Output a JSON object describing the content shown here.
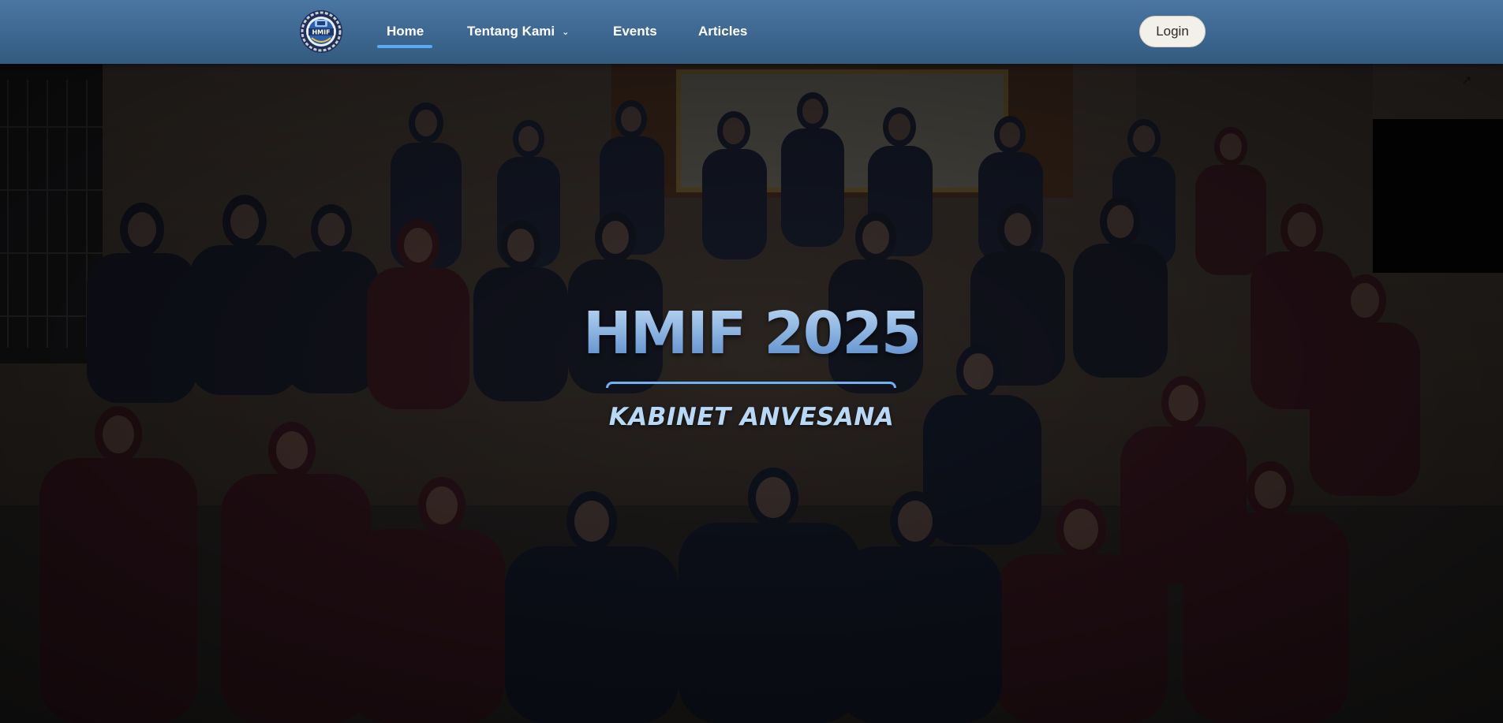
{
  "navbar": {
    "logo_text": "HMIF",
    "links": {
      "home": "Home",
      "about": "Tentang Kami",
      "events": "Events",
      "articles": "Articles"
    },
    "login_label": "Login",
    "colors": {
      "bar": "#3d6790",
      "active_underline": "#5aa9f2"
    }
  },
  "hero": {
    "title": "HMIF 2025",
    "subtitle": "KABINET ANVESANA"
  }
}
